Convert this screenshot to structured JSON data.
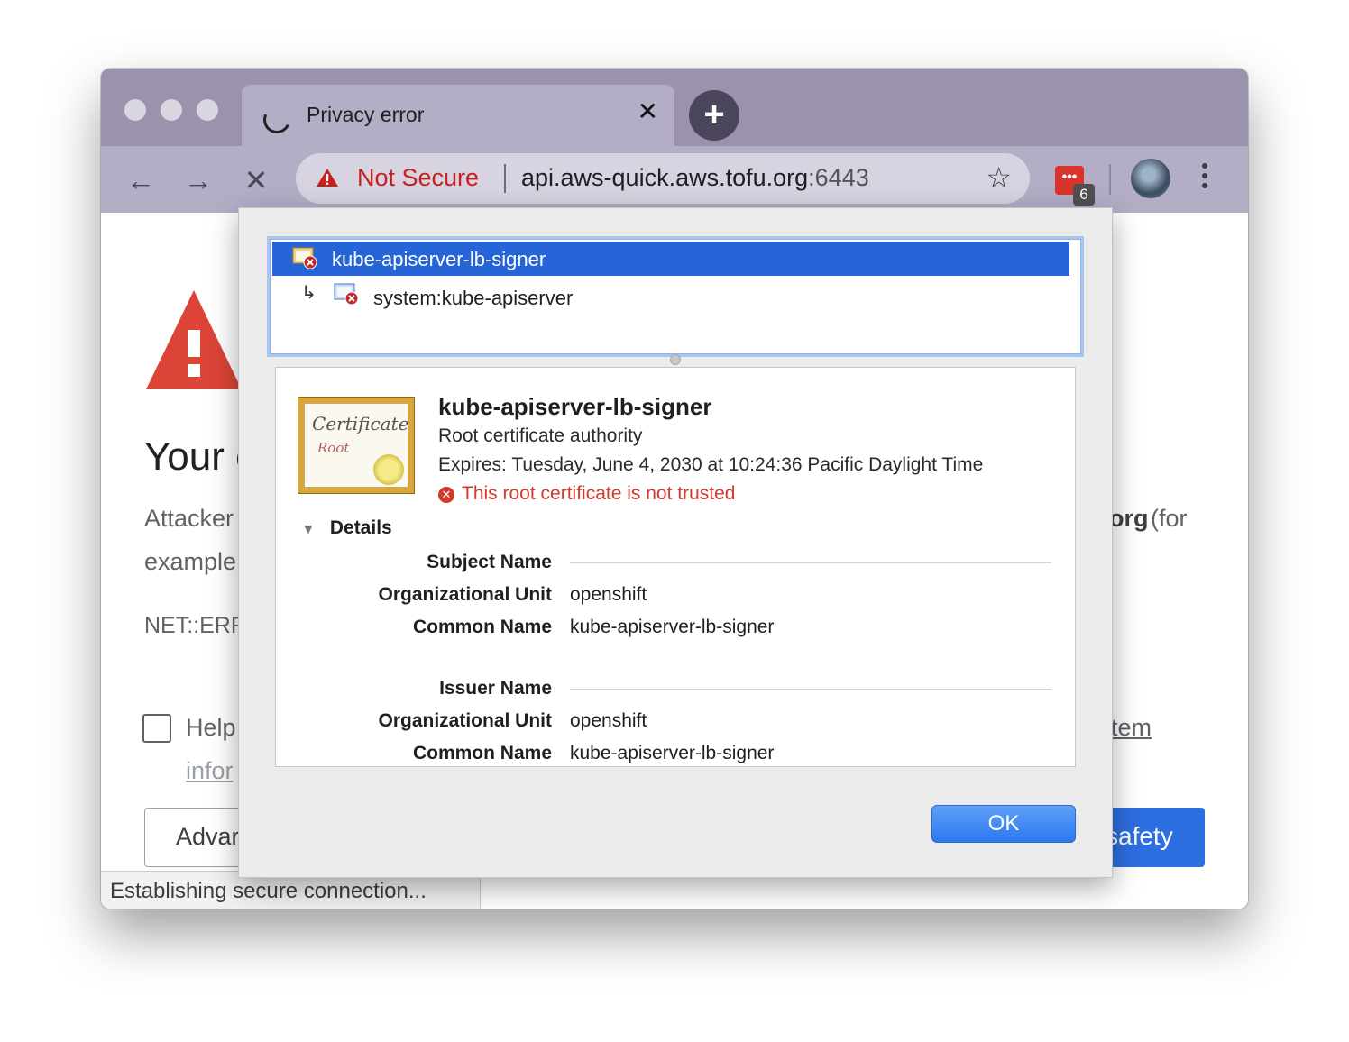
{
  "tab": {
    "title": "Privacy error",
    "close_glyph": "✕",
    "new_tab_glyph": "+"
  },
  "toolbar": {
    "back_glyph": "←",
    "forward_glyph": "→",
    "stop_glyph": "✕",
    "security_label": "Not Secure",
    "url_host": "api.aws-quick.aws.tofu.org",
    "url_port": ":6443",
    "bookmark_glyph": "☆",
    "extension_badge": "6",
    "menu_glyph": "⋮"
  },
  "page": {
    "heading_fragment": "Your c",
    "line1_start": "Attacker",
    "line1_end_bold": "org",
    "line1_end": " (for",
    "line2_start": "example",
    "error_code_fragment": "NET::ERR",
    "help_fragment": "Help",
    "help_end": "tem",
    "info_fragment": "infor",
    "advanced_fragment": "Advar",
    "safety_fragment": "safety"
  },
  "status_bar": {
    "text": "Establishing secure connection..."
  },
  "dialog": {
    "chain": [
      {
        "label": "kube-apiserver-lb-signer",
        "selected": true
      },
      {
        "label": "system:kube-apiserver",
        "selected": false
      }
    ],
    "chain_arrow": "↳",
    "cert_art": {
      "word": "Certificate",
      "sub": "Root"
    },
    "cert": {
      "name": "kube-apiserver-lb-signer",
      "kind": "Root certificate authority",
      "expires": "Expires: Tuesday, June 4, 2030 at 10:24:36 Pacific Daylight Time",
      "untrusted_icon": "✕",
      "untrusted": "This root certificate is not trusted"
    },
    "details_toggle": {
      "arrow": "▼",
      "label": "Details"
    },
    "subject": {
      "section": "Subject Name",
      "ou_label": "Organizational Unit",
      "ou_value": "openshift",
      "cn_label": "Common Name",
      "cn_value": "kube-apiserver-lb-signer"
    },
    "issuer": {
      "section": "Issuer Name",
      "ou_label": "Organizational Unit",
      "ou_value": "openshift",
      "cn_label": "Common Name",
      "cn_value": "kube-apiserver-lb-signer"
    },
    "ok_label": "OK"
  },
  "colors": {
    "titlebar": "#9b93ad",
    "toolbar": "#b3aec6",
    "not_secure": "#c5221f",
    "selection": "#2565d8",
    "error": "#d23a2c",
    "ok_button": "#2b78f0"
  }
}
